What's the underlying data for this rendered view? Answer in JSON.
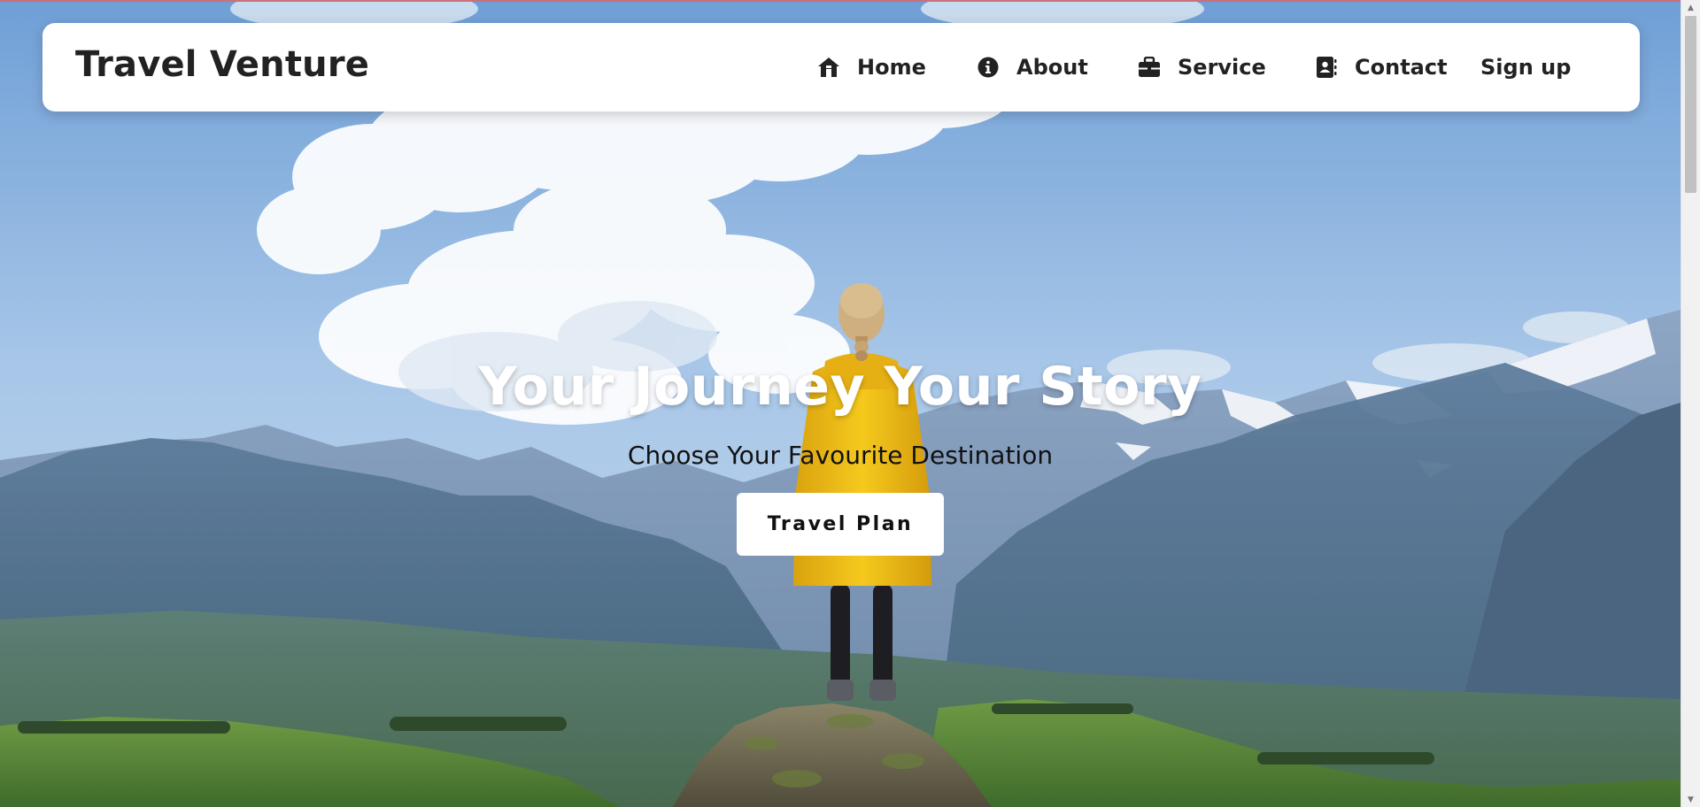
{
  "brand": {
    "name": "Travel Venture"
  },
  "nav": {
    "home": {
      "label": "Home",
      "icon": "home-icon"
    },
    "about": {
      "label": "About",
      "icon": "info-icon"
    },
    "service": {
      "label": "Service",
      "icon": "briefcase-icon"
    },
    "contact": {
      "label": "Contact",
      "icon": "address-book-icon"
    },
    "signup": {
      "label": "Sign up"
    }
  },
  "hero": {
    "title": "Your Journey Your Story",
    "subtitle": "Choose Your Favourite Destination",
    "cta_label": "Travel Plan"
  },
  "colors": {
    "navbar_bg": "#ffffff",
    "text_dark": "#222222",
    "raincoat_yellow": "#f1c21b",
    "sky_blue": "#8fb4dc"
  }
}
